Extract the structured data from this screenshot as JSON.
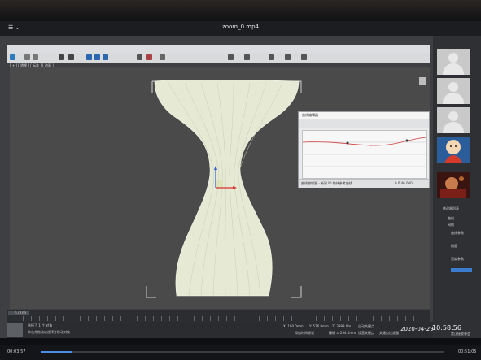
{
  "player": {
    "title": "zoom_0.mp4",
    "elapsed": "00:03:57",
    "duration": "00:51:05",
    "progress": 0.077
  },
  "max": {
    "viewport_label": "[ + ] [ 透视 ] [ 标准 ] [ 边面 ]",
    "frame_counter": "0 / 100",
    "status_line1": "选择了 1 个 对象",
    "status_line2": "单击并拖动以选择并移动对象",
    "coord_x": "X: 100.0mm",
    "coord_y": "Y: 576.0mm",
    "coord_z": "Z: 3993.0m",
    "grid": "栅格 = 254.0mm",
    "add_time_tag": "添加时间标记",
    "auto_key": "自动关键点",
    "set_key": "设置关键点",
    "keyframe_filter": "关键点过滤器",
    "curve_editor_title": "曲线编辑器",
    "curve_editor_status": "曲线编辑器 - 新建 ID 物体参考曲线",
    "curve_coords": "0.0  46.000"
  },
  "panel": {
    "modifier_list": "修改器列表",
    "item1": "曲线",
    "item2": "网格",
    "section1": "曲线参数",
    "section2": "插值",
    "section3": "渲染参数",
    "footer": "禁止接收参会"
  },
  "taskbar": {
    "date": "2020-04-29",
    "time": "10:58:56"
  },
  "colors": {
    "accent_progress": "#4a8fe6",
    "viewport_bg": "#4a4a4a",
    "model_fill": "#e6ead5"
  },
  "icons": [
    "menu-icon",
    "user-avatar-icon",
    "cartoon-avatar-icon",
    "play-icon",
    "gear-icon"
  ]
}
